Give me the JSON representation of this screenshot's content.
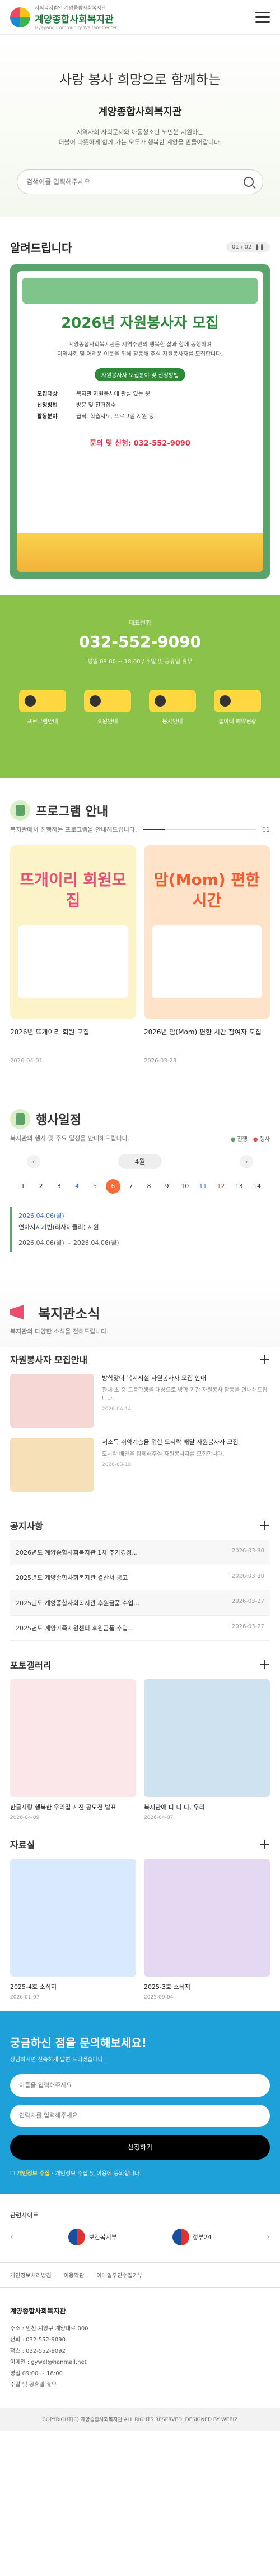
{
  "header": {
    "sub": "사회복지법인 계양종합사회복지관",
    "title": "계양종합사회복지관",
    "en": "Gyeyang Community Welfare Center"
  },
  "hero": {
    "slogan": "사랑 봉사 희망으로 함께하는",
    "title": "계양종합사회복지관",
    "desc1": "지역사회 사회문제와 아동청소년 노인분 지원하는",
    "desc2": "더불어 따뜻하게 함께 가는 모두가 행복한 계양을 만들어갑니다.",
    "search_placeholder": "검색어를 입력해주세요"
  },
  "notice": {
    "title": "알려드립니다",
    "pager": "01 / 02",
    "poster_title": "2026년 자원봉사자 모집",
    "poster_desc1": "계양종합사회복지관은 지역주민의 행복한 삶과 함께 동행하며",
    "poster_desc2": "지역사회 및 어려운 이웃을 위해 활동해 주실 자원봉사자를 모집합니다.",
    "badge": "자원봉사자 모집분야 및 신청방법",
    "rows": [
      {
        "k": "모집대상",
        "v": "복지관 자원봉사에 관심 있는 분"
      },
      {
        "k": "신청방법",
        "v": "방문 및 전화접수"
      },
      {
        "k": "활동분야",
        "v": "급식, 학습지도, 프로그램 지원 등"
      }
    ],
    "tel": "문의 및 신청: 032-552-9090"
  },
  "contact": {
    "label": "대표전화",
    "tel": "032-552-9090",
    "time": "평일 09:00 ~ 18:00 / 주말 및 공휴일 휴무"
  },
  "quick": [
    {
      "label": "프로그램안내"
    },
    {
      "label": "후원안내"
    },
    {
      "label": "봉사안내"
    },
    {
      "label": "놀이터 예약현황"
    }
  ],
  "program": {
    "title": "프로그램 안내",
    "desc": "복지관에서 진행하는 프로그램을 안내해드립니다.",
    "pager": "01",
    "cards": [
      {
        "img_title": "뜨개이리 회원모집",
        "caption": "2026년 뜨개이리 회원 모집",
        "date": "2026-04-01"
      },
      {
        "img_title": "맘(Mom) 편한 시간",
        "caption": "2026년 맘(Mom) 편한 시간 참여자 모집",
        "date": "2026-03-23"
      }
    ]
  },
  "schedule": {
    "title": "행사일정",
    "desc": "복지관의 행사 및 주요 일정을 안내해드립니다.",
    "legend1": "진행",
    "legend2": "행사",
    "month": "4월",
    "days": [
      "1",
      "2",
      "3",
      "4",
      "5",
      "6",
      "7",
      "8",
      "9",
      "10",
      "11",
      "12",
      "13",
      "14"
    ],
    "event_date": "2026.04.06(월)",
    "event_title": "연아지지기반(리사이클리) 지원",
    "event_period": "2026.04.06(월) ~ 2026.04.06(월)"
  },
  "news": {
    "title": "복지관소식",
    "desc": "복지관의 다양한 소식을 전해드립니다."
  },
  "volunteer": {
    "title": "자원봉사자 모집안내",
    "items": [
      {
        "t": "방학맞이 복지시설 자원봉사자 모집 안내",
        "d": "관내 초·중·고등학생을 대상으로 방학 기간 자원봉사 활동을 안내해드립니다.",
        "c": "2026-04-14"
      },
      {
        "t": "저소득 취약계층을 위한 도시락 배달 자원봉사자 모집",
        "d": "도시락 배달을 함께해주실 자원봉사자를 모집합니다.",
        "c": "2026-03-18"
      }
    ]
  },
  "notices": {
    "title": "공지사항",
    "items": [
      {
        "t": "2026년도 계양종합사회복지관 1차 추가경정...",
        "d": "2026-03-30"
      },
      {
        "t": "2025년도 계양종합사회복지관 결산서 공고",
        "d": "2026-03-30"
      },
      {
        "t": "2025년도 계양종합사회복지관 후원금품 수입...",
        "d": "2026-03-27"
      },
      {
        "t": "2025년도 계양가족지원센터 후원금품 수입...",
        "d": "2026-03-27"
      }
    ]
  },
  "gallery": {
    "title": "포토갤러리",
    "items": [
      {
        "c": "한글사랑 행복한 우리집 사진 공모전 발표",
        "d": "2026-04-09"
      },
      {
        "c": "복지관에 다 나 나, 우리",
        "d": "2026-04-07"
      }
    ]
  },
  "resources": {
    "title": "자료실",
    "items": [
      {
        "c": "2025-4호 소식지",
        "d": "2026-01-07"
      },
      {
        "c": "2025-3호 소식지",
        "d": "2025-09-04"
      }
    ]
  },
  "inquiry": {
    "title": "궁금하신 점을 문의해보세요!",
    "desc": "상담하시면 신속하게 답변 드리겠습니다.",
    "name_ph": "이름을 입력해주세요",
    "phone_ph": "연락처를 입력해주세요",
    "submit": "신청하기",
    "agree": "개인정보 수집 및 이용에 동의합니다.",
    "agree_strong": "개인정보 수집"
  },
  "related": {
    "title": "관련사이트",
    "left": "보건복지부",
    "right": "정부24"
  },
  "footer_links": [
    "개인정보처리방침",
    "이용약관",
    "이메일무단수집거부"
  ],
  "footer": {
    "name": "계양종합사회복지관",
    "addr": "주소 : 인천 계양구 계양대로 000",
    "tel": "전화 : 032-552-9090",
    "fax": "팩스 : 032-552-9092",
    "email": "이메일 : gywel@hanmail.net",
    "hours": "평일 09:00 ~ 18:00",
    "closed": "주말 및 공휴일 휴무",
    "copy": "COPYRIGHT(C) 계양종합사회복지관 ALL RIGHTS RESERVED. DESIGNED BY WEBIZ"
  }
}
